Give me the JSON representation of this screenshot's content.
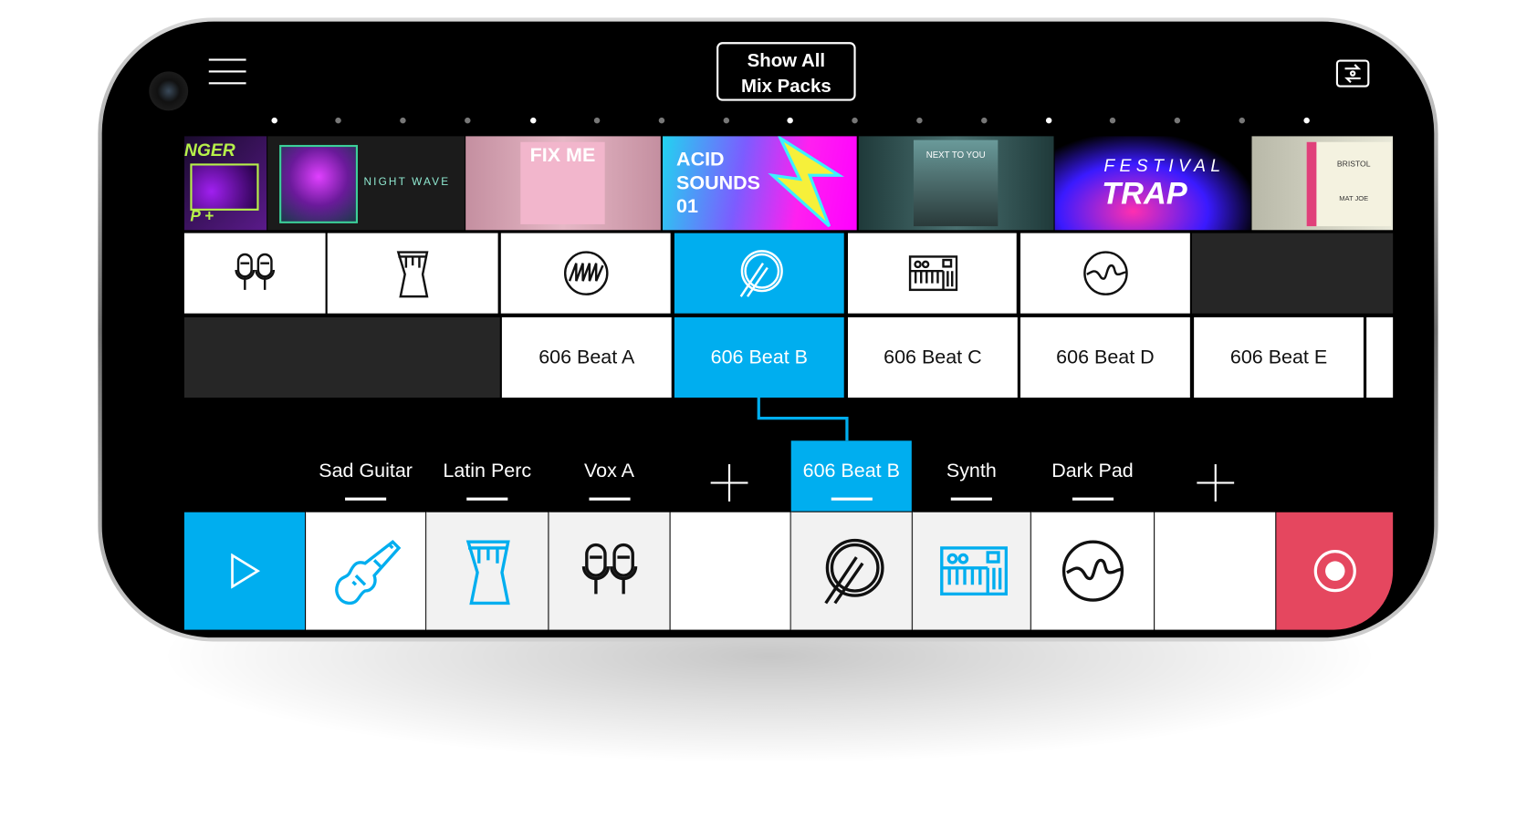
{
  "header": {
    "show_all_line1": "Show All",
    "show_all_line2": "Mix Packs",
    "menu_icon": "hamburger-menu-icon",
    "swap_icon": "swap-view-icon"
  },
  "carousel": {
    "pages": 17,
    "active_dots": [
      0,
      4,
      8,
      12,
      16
    ]
  },
  "albums": [
    {
      "title": "NGER",
      "sub": "P +"
    },
    {
      "title": "NIGHT WAVE"
    },
    {
      "title": "FIX ME"
    },
    {
      "title": "ACID SOUNDS 01"
    },
    {
      "title": "NEXT TO YOU"
    },
    {
      "title": "FESTIVAL",
      "sub": "TRAP"
    },
    {
      "title": "BRISTOL",
      "sub": "MAT JOE"
    }
  ],
  "instruments": [
    {
      "icon": "microphones-icon",
      "selected": false
    },
    {
      "icon": "hand-drum-icon",
      "selected": false
    },
    {
      "icon": "sawtooth-wave-icon",
      "selected": false
    },
    {
      "icon": "drum-sticks-icon",
      "selected": true
    },
    {
      "icon": "synth-keyboard-icon",
      "selected": false
    },
    {
      "icon": "pad-wave-icon",
      "selected": false
    }
  ],
  "beats": [
    {
      "label": "606 Beat A",
      "selected": false
    },
    {
      "label": "606 Beat B",
      "selected": true
    },
    {
      "label": "606 Beat C",
      "selected": false
    },
    {
      "label": "606 Beat D",
      "selected": false
    },
    {
      "label": "606 Beat E",
      "selected": false
    }
  ],
  "tracks": [
    {
      "label": "Sad Guitar",
      "icon": "electric-guitar-icon",
      "selected": false
    },
    {
      "label": "Latin Perc",
      "icon": "hand-drum-icon",
      "selected": false
    },
    {
      "label": "Vox A",
      "icon": "microphones-icon",
      "selected": false
    },
    {
      "label": "606 Beat B",
      "icon": "drum-sticks-icon",
      "selected": true
    },
    {
      "label": "Synth",
      "icon": "synth-keyboard-icon",
      "selected": false
    },
    {
      "label": "Dark Pad",
      "icon": "pad-wave-icon",
      "selected": false
    }
  ],
  "transport": {
    "play_icon": "play-icon",
    "record_icon": "record-icon"
  },
  "colors": {
    "accent": "#00aeef",
    "record": "#e5475f",
    "empty": "#262626",
    "gray_cell": "#f2f2f2"
  }
}
